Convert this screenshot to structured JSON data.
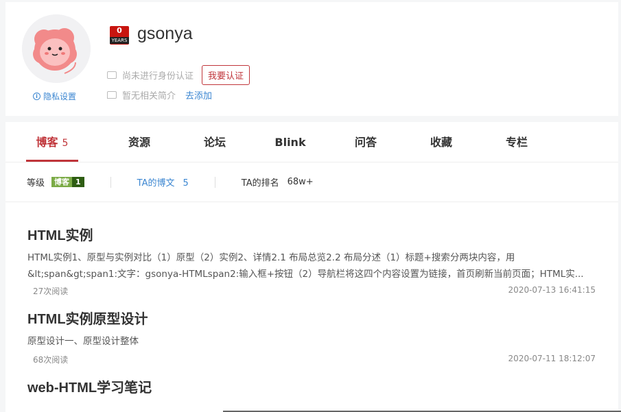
{
  "profile": {
    "username": "gsonya",
    "badge_number": "0",
    "badge_label": "YEARS",
    "privacy_label": "隐私设置",
    "verify_status": "尚未进行身份认证",
    "verify_button": "我要认证",
    "bio_status": "暂无相关简介",
    "bio_add": "去添加"
  },
  "tabs": [
    {
      "label": "博客",
      "count": "5"
    },
    {
      "label": "资源"
    },
    {
      "label": "论坛"
    },
    {
      "label": "Blink"
    },
    {
      "label": "问答"
    },
    {
      "label": "收藏"
    },
    {
      "label": "专栏"
    }
  ],
  "stats": {
    "level_label": "等级",
    "level_badge_name": "博客",
    "level_badge_value": "1",
    "posts_label": "TA的博文",
    "posts_value": "5",
    "rank_label": "TA的排名",
    "rank_value": "68w+"
  },
  "articles": [
    {
      "title": "HTML实例",
      "desc_line1": "HTML实例1、原型与实例对比（1）原型（2）实例2、详情2.1 布局总览2.2 布局分述（1）标题+搜索分两块内容，用",
      "desc_line2": "&lt;span&gt;span1:文字：gsonya-HTMLspan2:输入框+按钮（2）导航栏将这四个内容设置为链接，首页刷新当前页面；HTML实...",
      "reads": "27次阅读",
      "date": "2020-07-13 16:41:15"
    },
    {
      "title": "HTML实例原型设计",
      "desc_line1": "原型设计一、原型设计整体",
      "reads": "68次阅读",
      "date": "2020-07-11 18:12:07"
    },
    {
      "title": "web-HTML学习笔记"
    }
  ],
  "colors": {
    "accent": "#c0353a",
    "link": "#3b86d1"
  }
}
